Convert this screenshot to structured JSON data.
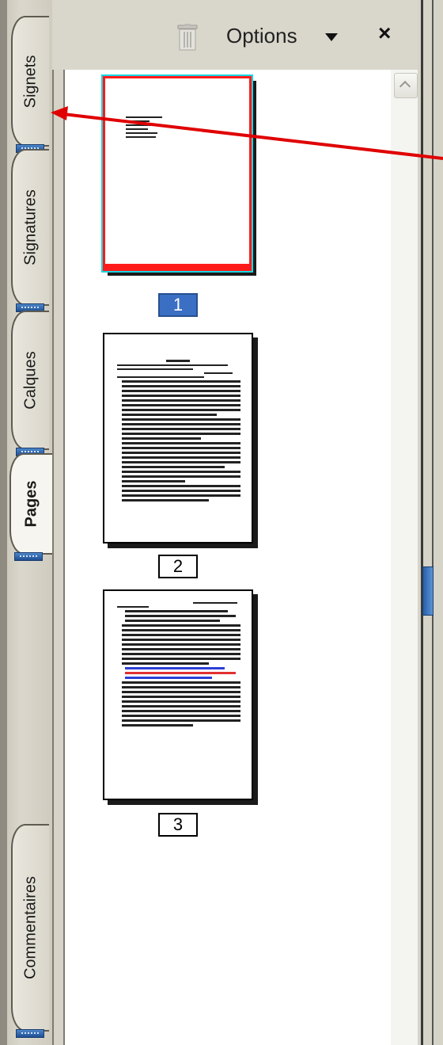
{
  "tabs": [
    {
      "label": "Signets",
      "active": false
    },
    {
      "label": "Signatures",
      "active": false
    },
    {
      "label": "Calques",
      "active": false
    },
    {
      "label": "Pages",
      "active": true
    },
    {
      "label": "Commentaires",
      "active": false
    }
  ],
  "header": {
    "options_label": "Options",
    "trash_icon": "trash-icon",
    "close_label": "×"
  },
  "thumbnails": [
    {
      "page": "1",
      "selected": true
    },
    {
      "page": "2",
      "selected": false
    },
    {
      "page": "3",
      "selected": false
    }
  ],
  "colors": {
    "selected_page_border": "#ff1a1a",
    "selected_page_number_bg": "#3a6fc4",
    "annotation_arrow": "#e00000"
  }
}
